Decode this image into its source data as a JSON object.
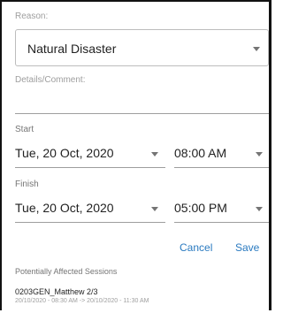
{
  "reason": {
    "label": "Reason:",
    "value": "Natural Disaster"
  },
  "details": {
    "label": "Details/Comment:",
    "value": ""
  },
  "start": {
    "label": "Start",
    "date": "Tue, 20 Oct, 2020",
    "time": "08:00 AM"
  },
  "finish": {
    "label": "Finish",
    "date": "Tue, 20 Oct, 2020",
    "time": "05:00 PM"
  },
  "actions": {
    "cancel": "Cancel",
    "save": "Save"
  },
  "affected": {
    "header": "Potentially Affected Sessions",
    "sessions": [
      {
        "name": "0203GEN_Matthew 2/3",
        "time_range": "20/10/2020 - 08:30 AM -> 20/10/2020 - 11:30 AM"
      }
    ]
  },
  "icons": {
    "dropdown": "chevron-down-icon"
  }
}
